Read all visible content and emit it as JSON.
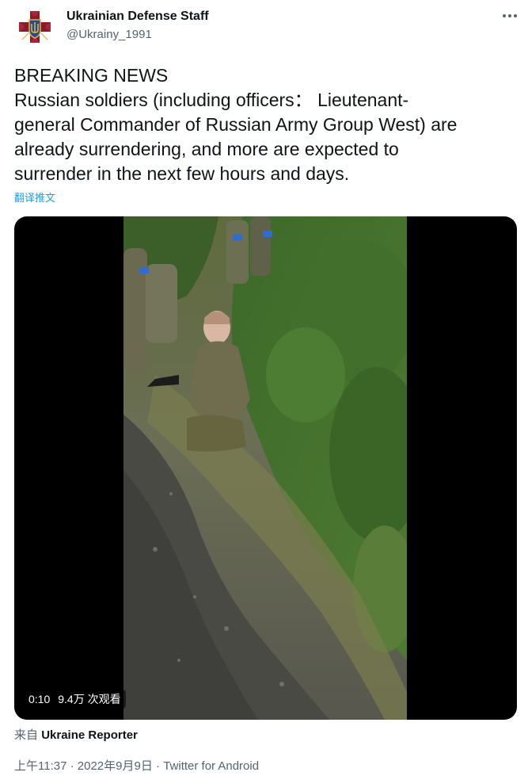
{
  "author": {
    "name": "Ukrainian Defense Staff",
    "handle": "@Ukrainy_1991",
    "avatar_icon": "ukraine-armed-forces-emblem-icon"
  },
  "tweet": {
    "lines": [
      "BREAKING NEWS",
      "Russian soldiers (including officers： Lieutenant-",
      "general Commander of Russian Army Group West) are",
      "already surrendering, and more are expected to",
      "surrender in the next few hours and days."
    ],
    "translate_label": "翻译推文"
  },
  "media": {
    "type": "video",
    "duration": "0:10",
    "views": "9.4万 次观看"
  },
  "source": {
    "prefix": "来自",
    "name": "Ukraine Reporter"
  },
  "meta": {
    "time": "上午11:37",
    "separator": "·",
    "date": "2022年9月9日",
    "client": "Twitter for Android"
  },
  "colors": {
    "text": "#0f1419",
    "secondary": "#536471",
    "link": "#1d9bf0",
    "avatar_emblem": "#8b1a2b",
    "avatar_accent": "#e2b23a"
  }
}
